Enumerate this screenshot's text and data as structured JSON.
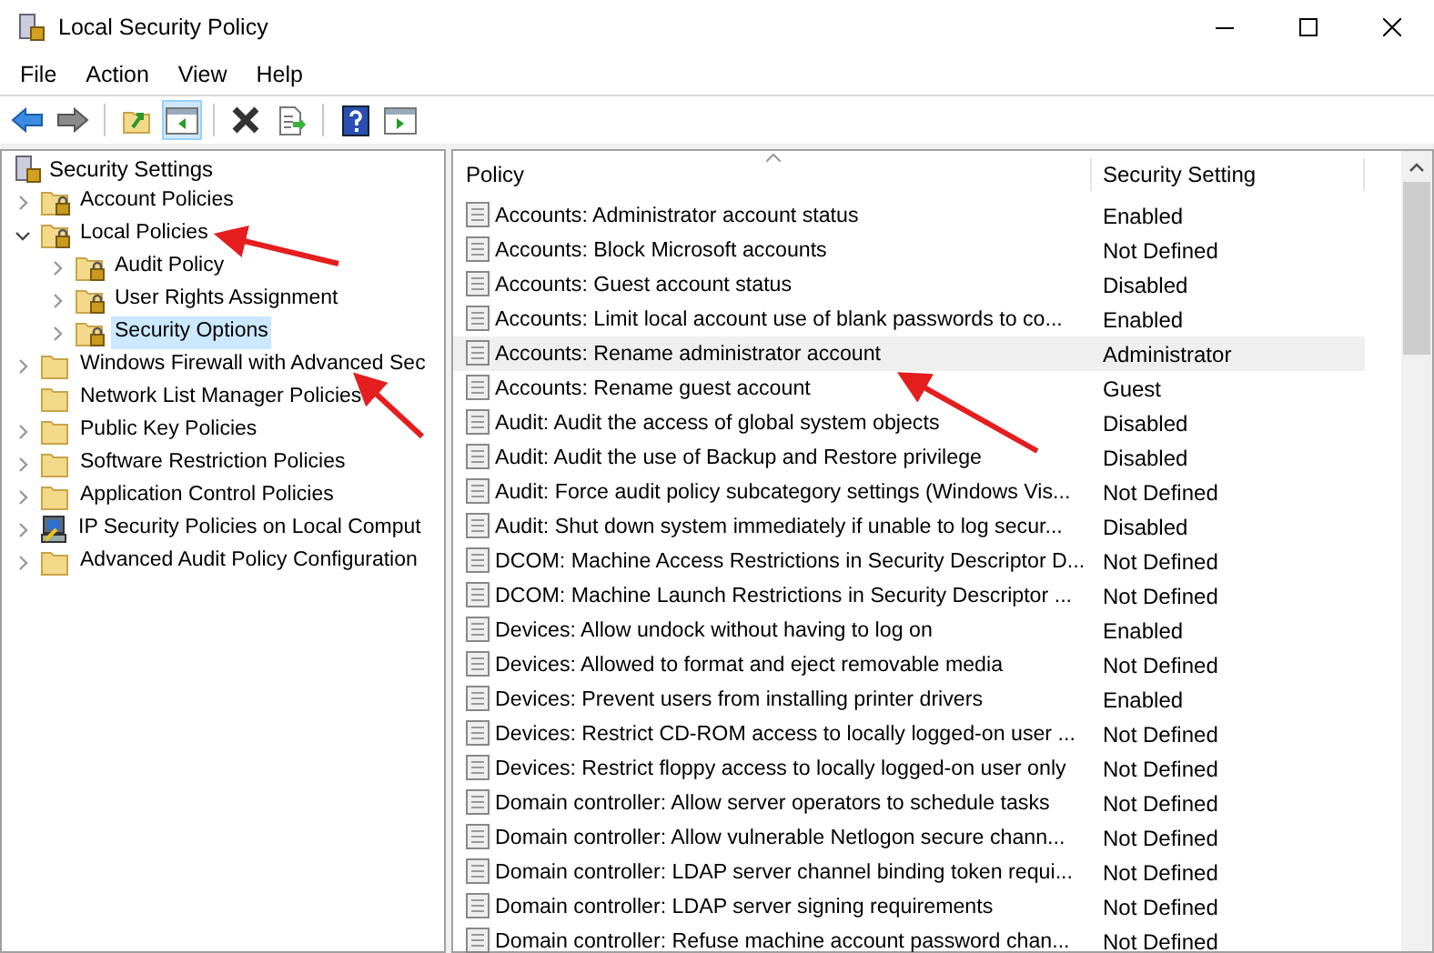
{
  "window": {
    "title": "Local Security Policy"
  },
  "menu": [
    {
      "label": "File"
    },
    {
      "label": "Action"
    },
    {
      "label": "View"
    },
    {
      "label": "Help"
    }
  ],
  "toolbar": [
    {
      "kind": "back",
      "selected": false
    },
    {
      "kind": "forward",
      "selected": false
    },
    {
      "kind": "sep"
    },
    {
      "kind": "up",
      "selected": false
    },
    {
      "kind": "tree",
      "selected": true
    },
    {
      "kind": "sep"
    },
    {
      "kind": "delete",
      "selected": false
    },
    {
      "kind": "export",
      "selected": false
    },
    {
      "kind": "sep"
    },
    {
      "kind": "help",
      "selected": false
    },
    {
      "kind": "pane",
      "selected": false
    }
  ],
  "tree": {
    "label": "Security Settings",
    "children": [
      {
        "label": "Account Policies",
        "kind": "locked",
        "expanded": false,
        "selected": false
      },
      {
        "label": "Local Policies",
        "kind": "locked",
        "expanded": true,
        "selected": false,
        "children": [
          {
            "label": "Audit Policy",
            "kind": "locked",
            "expanded": false,
            "selected": false
          },
          {
            "label": "User Rights Assignment",
            "kind": "locked",
            "expanded": false,
            "selected": false
          },
          {
            "label": "Security Options",
            "kind": "locked",
            "expanded": false,
            "selected": true
          }
        ]
      },
      {
        "label": "Windows Firewall with Advanced Sec",
        "kind": "folder",
        "expanded": false,
        "selected": false
      },
      {
        "label": "Network List Manager Policies",
        "kind": "folder",
        "leaf": true,
        "selected": false
      },
      {
        "label": "Public Key Policies",
        "kind": "folder",
        "expanded": false,
        "selected": false
      },
      {
        "label": "Software Restriction Policies",
        "kind": "folder",
        "expanded": false,
        "selected": false
      },
      {
        "label": "Application Control Policies",
        "kind": "folder",
        "expanded": false,
        "selected": false
      },
      {
        "label": "IP Security Policies on Local Comput",
        "kind": "computer",
        "expanded": false,
        "selected": false
      },
      {
        "label": "Advanced Audit Policy Configuration",
        "kind": "folder",
        "expanded": false,
        "selected": false
      }
    ]
  },
  "table": {
    "columns": [
      "Policy",
      "Security Setting"
    ],
    "rows": [
      {
        "policy": "Accounts: Administrator account status",
        "setting": "Enabled",
        "selected": false
      },
      {
        "policy": "Accounts: Block Microsoft accounts",
        "setting": "Not Defined",
        "selected": false
      },
      {
        "policy": "Accounts: Guest account status",
        "setting": "Disabled",
        "selected": false
      },
      {
        "policy": "Accounts: Limit local account use of blank passwords to co...",
        "setting": "Enabled",
        "selected": false
      },
      {
        "policy": "Accounts: Rename administrator account",
        "setting": "Administrator",
        "selected": true
      },
      {
        "policy": "Accounts: Rename guest account",
        "setting": "Guest",
        "selected": false
      },
      {
        "policy": "Audit: Audit the access of global system objects",
        "setting": "Disabled",
        "selected": false
      },
      {
        "policy": "Audit: Audit the use of Backup and Restore privilege",
        "setting": "Disabled",
        "selected": false
      },
      {
        "policy": "Audit: Force audit policy subcategory settings (Windows Vis...",
        "setting": "Not Defined",
        "selected": false
      },
      {
        "policy": "Audit: Shut down system immediately if unable to log secur...",
        "setting": "Disabled",
        "selected": false
      },
      {
        "policy": "DCOM: Machine Access Restrictions in Security Descriptor D...",
        "setting": "Not Defined",
        "selected": false
      },
      {
        "policy": "DCOM: Machine Launch Restrictions in Security Descriptor ...",
        "setting": "Not Defined",
        "selected": false
      },
      {
        "policy": "Devices: Allow undock without having to log on",
        "setting": "Enabled",
        "selected": false
      },
      {
        "policy": "Devices: Allowed to format and eject removable media",
        "setting": "Not Defined",
        "selected": false
      },
      {
        "policy": "Devices: Prevent users from installing printer drivers",
        "setting": "Enabled",
        "selected": false
      },
      {
        "policy": "Devices: Restrict CD-ROM access to locally logged-on user ...",
        "setting": "Not Defined",
        "selected": false
      },
      {
        "policy": "Devices: Restrict floppy access to locally logged-on user only",
        "setting": "Not Defined",
        "selected": false
      },
      {
        "policy": "Domain controller: Allow server operators to schedule tasks",
        "setting": "Not Defined",
        "selected": false
      },
      {
        "policy": "Domain controller: Allow vulnerable Netlogon secure chann...",
        "setting": "Not Defined",
        "selected": false
      },
      {
        "policy": "Domain controller: LDAP server channel binding token requi...",
        "setting": "Not Defined",
        "selected": false
      },
      {
        "policy": "Domain controller: LDAP server signing requirements",
        "setting": "Not Defined",
        "selected": false
      },
      {
        "policy": "Domain controller: Refuse machine account password chan...",
        "setting": "Not Defined",
        "selected": false
      }
    ]
  }
}
